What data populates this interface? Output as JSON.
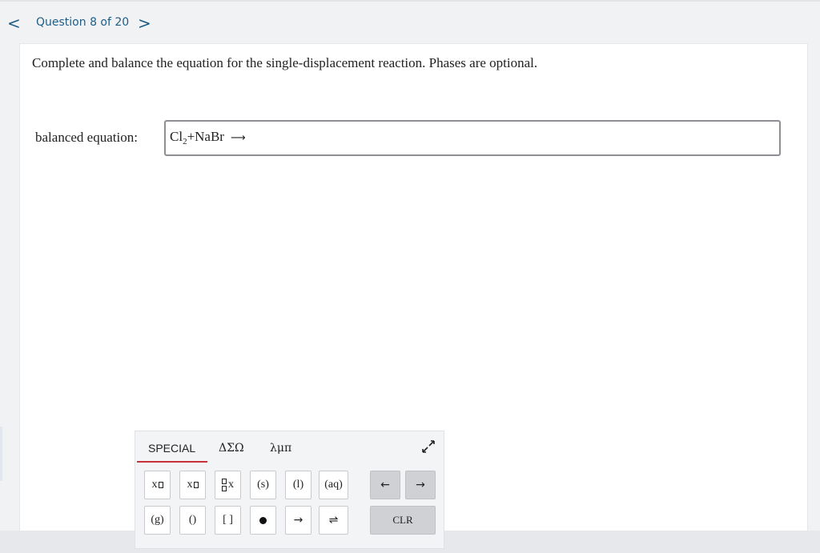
{
  "nav": {
    "prev_symbol": "<",
    "label": "Question 8 of 20",
    "next_symbol": ">"
  },
  "question": {
    "prompt": "Complete and balance the equation for the single-displacement reaction. Phases are optional.",
    "answer_label": "balanced equation:",
    "answer": {
      "cl": "Cl",
      "cl_sub": "2",
      "rest": "+NaBr",
      "arrow": "⟶"
    }
  },
  "palette": {
    "tabs": [
      "SPECIAL",
      "ΔΣΩ",
      "λμπ"
    ],
    "active_tab": "SPECIAL",
    "accent_color": "#c9323a",
    "buttons": {
      "superscript_x": "x",
      "subscript_x": "x",
      "stacked_x": "x",
      "solid": "(s)",
      "liquid": "(l)",
      "aqueous": "(aq)",
      "gas": "(g)",
      "parens": "()",
      "brackets": "[ ]",
      "arrow": "→",
      "equilibrium": "⇌",
      "left_arrow": "←",
      "right_arrow": "→",
      "clear": "CLR"
    },
    "icons": {
      "collapse": "collapse-arrows-icon",
      "nav_prev": "chevron-left-icon",
      "nav_next": "chevron-right-icon"
    }
  },
  "colors": {
    "link_blue": "#1f5d86",
    "input_border": "#8d8f93"
  }
}
